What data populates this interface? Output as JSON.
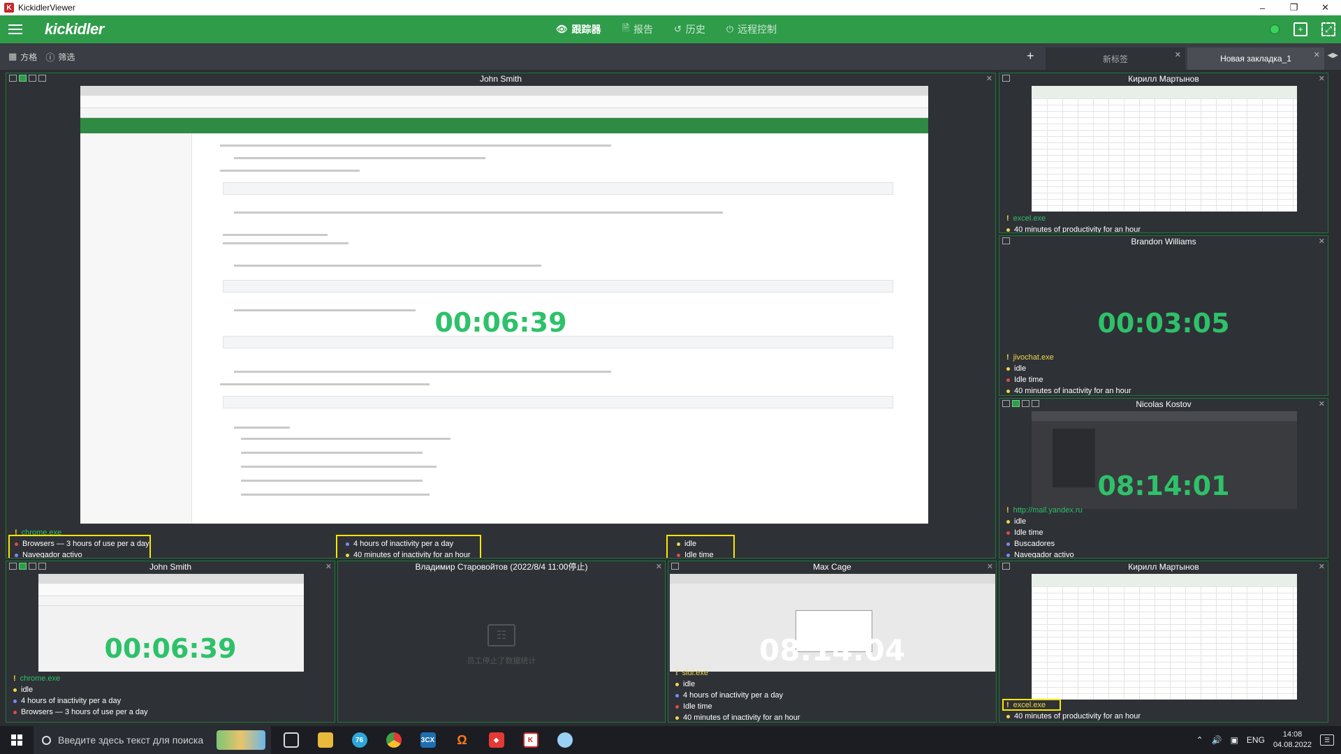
{
  "window": {
    "title": "KickidlerViewer"
  },
  "toolbar": {
    "logo": "KICKIDLER",
    "nav": [
      {
        "icon": "eye-icon",
        "label": "跟踪器"
      },
      {
        "icon": "document-icon",
        "label": "报告"
      },
      {
        "icon": "history-icon",
        "label": "历史"
      },
      {
        "icon": "remote-control-icon",
        "label": "远程控制"
      }
    ]
  },
  "subbar": {
    "grid_label": "方格",
    "filter_label": "筛选",
    "add_tab": "+",
    "tabs": [
      {
        "label": "新标签"
      },
      {
        "label": "Новая закладка_1"
      }
    ]
  },
  "tiles": {
    "main": {
      "name": "John Smith",
      "timer": "00:06:39",
      "process": "chrome.exe",
      "stats_a": [
        "Browsers — 3 hours of use per a day",
        "Navegador activo"
      ],
      "stats_b": [
        "4 hours of inactivity per a day",
        "40 minutes of inactivity for an hour"
      ],
      "stats_c": [
        "idle",
        "Idle time"
      ]
    },
    "r1": {
      "name": "Кирилл Мартынов",
      "process": "excel.exe",
      "stats": [
        "40 minutes of productivity for an hour"
      ]
    },
    "r2": {
      "name": "Brandon Williams",
      "timer": "00:03:05",
      "process": "jivochat.exe",
      "stats": [
        "idle",
        "Idle time",
        "40 minutes of inactivity for an hour"
      ]
    },
    "r3": {
      "name": "Nicolas Kostov",
      "timer": "08:14:01",
      "process": "http://mail.yandex.ru",
      "stats": [
        "idle",
        "Idle time",
        "Buscadores",
        "Navegador activo"
      ]
    },
    "b1": {
      "name": "John Smith",
      "timer": "00:06:39",
      "process": "chrome.exe",
      "stats": [
        "idle",
        "4 hours of inactivity per a day",
        "Browsers — 3 hours of use per a day"
      ]
    },
    "b2": {
      "name": "Владимир Старовойтов (2022/8/4 11:00停止)",
      "stopped_text": "员工停止了数据统计"
    },
    "b3": {
      "name": "Max Cage",
      "timer": "08:14:04",
      "process": "slui.exe",
      "stats": [
        "idle",
        "4 hours of inactivity per a day",
        "Idle time",
        "40 minutes of inactivity for an hour"
      ]
    },
    "b4": {
      "name": "Кирилл Мартынов",
      "process": "excel.exe",
      "stats": [
        "40 minutes of productivity for an hour"
      ]
    }
  },
  "taskbar": {
    "search_placeholder": "Введите здесь текст для поиска",
    "lang": "ENG",
    "time": "14:08",
    "date": "04.08.2022",
    "telegram_badge": "76"
  },
  "colors": {
    "accent_green": "#2f9c4a",
    "timer_green": "#2ec16a",
    "highlight_yellow": "#ffe600"
  }
}
